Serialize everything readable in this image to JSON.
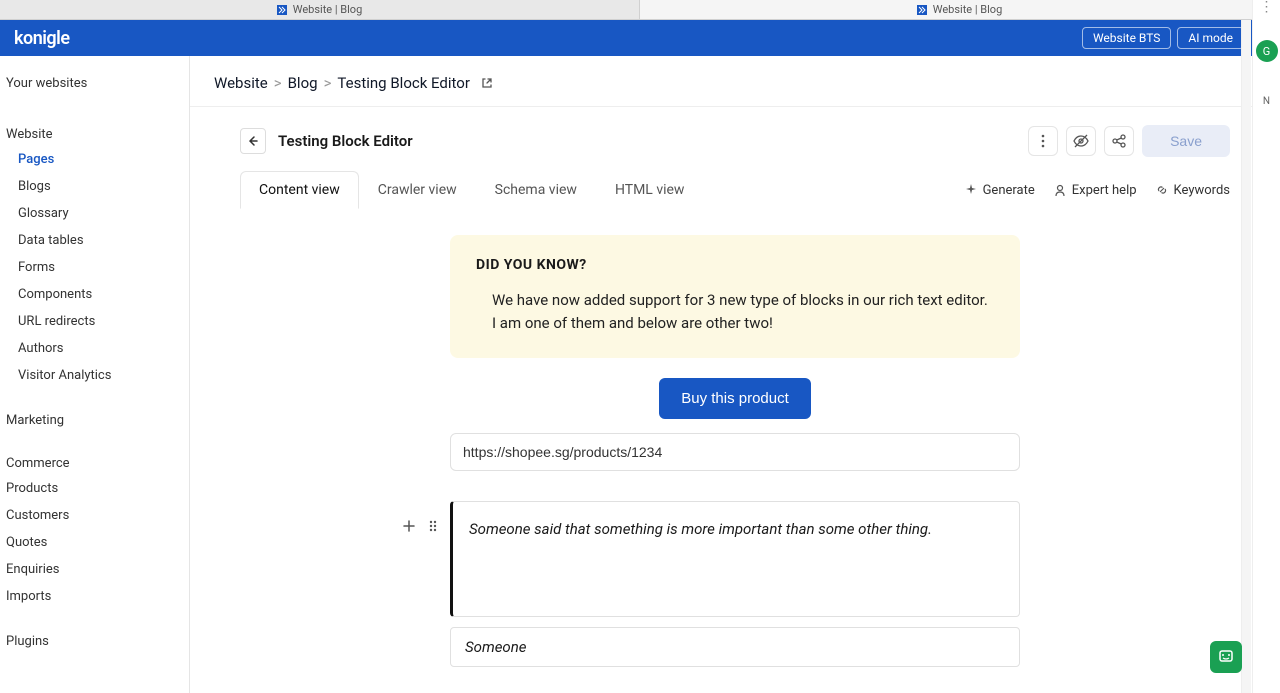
{
  "browser_tabs": {
    "tab1": "Website | Blog",
    "tab2": "Website | Blog"
  },
  "header": {
    "logo": "konigle",
    "mode1": "Website BTS",
    "mode2": "AI mode"
  },
  "right_strip": {
    "avatar_letter": "G",
    "side_letter": "N"
  },
  "sidebar": {
    "heading": "Your websites",
    "sections": {
      "website": {
        "label": "Website",
        "items": [
          "Pages",
          "Blogs",
          "Glossary",
          "Data tables",
          "Forms",
          "Components",
          "URL redirects",
          "Authors",
          "Visitor Analytics"
        ]
      },
      "marketing": {
        "label": "Marketing"
      },
      "commerce": {
        "label": "Commerce",
        "items": [
          "Products",
          "Customers",
          "Quotes",
          "Enquiries",
          "Imports"
        ]
      },
      "plugins": {
        "label": "Plugins"
      }
    }
  },
  "breadcrumb": {
    "a": "Website",
    "b": "Blog",
    "c": "Testing Block Editor"
  },
  "title_row": {
    "title": "Testing Block Editor",
    "save_label": "Save"
  },
  "tabs": {
    "t0": "Content view",
    "t1": "Crawler view",
    "t2": "Schema view",
    "t3": "HTML view",
    "generate": "Generate",
    "expert": "Expert help",
    "keywords": "Keywords"
  },
  "content": {
    "callout_title": "DID YOU KNOW?",
    "callout_body": "We have now added support for 3 new type of blocks in our rich text editor. I am one of them and below are other two!",
    "buy_label": "Buy this product",
    "url_value": "https://shopee.sg/products/1234",
    "quote_text": "Someone said that something is more important than some other thing.",
    "quote_author": "Someone"
  }
}
